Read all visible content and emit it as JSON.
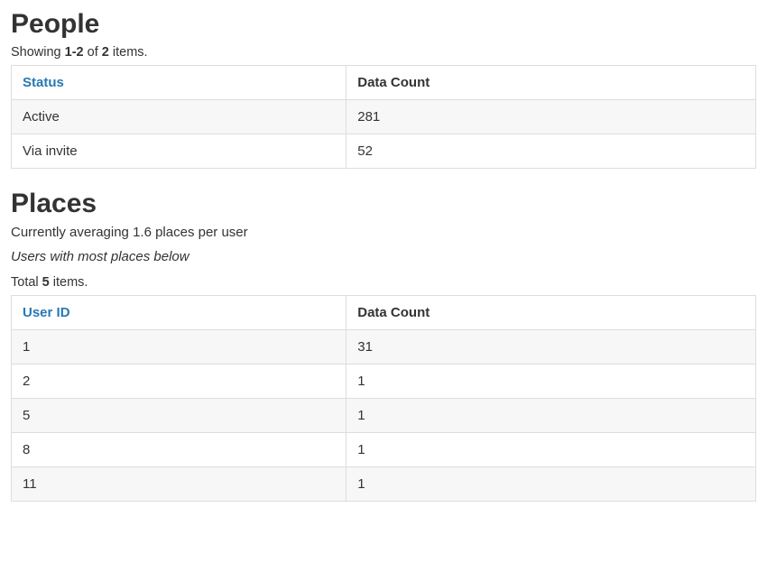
{
  "people": {
    "heading": "People",
    "summary_prefix": "Showing ",
    "summary_range": "1-2",
    "summary_mid": " of ",
    "summary_total": "2",
    "summary_suffix": " items.",
    "columns": {
      "status": "Status",
      "count": "Data Count"
    },
    "rows": [
      {
        "status": "Active",
        "count": "281"
      },
      {
        "status": "Via invite",
        "count": "52"
      }
    ]
  },
  "places": {
    "heading": "Places",
    "avg_line": "Currently averaging 1.6 places per user",
    "subhead": "Users with most places below",
    "total_prefix": "Total ",
    "total_count": "5",
    "total_suffix": " items.",
    "columns": {
      "user_id": "User ID",
      "count": "Data Count"
    },
    "rows": [
      {
        "user_id": "1",
        "count": "31"
      },
      {
        "user_id": "2",
        "count": "1"
      },
      {
        "user_id": "5",
        "count": "1"
      },
      {
        "user_id": "8",
        "count": "1"
      },
      {
        "user_id": "11",
        "count": "1"
      }
    ]
  }
}
